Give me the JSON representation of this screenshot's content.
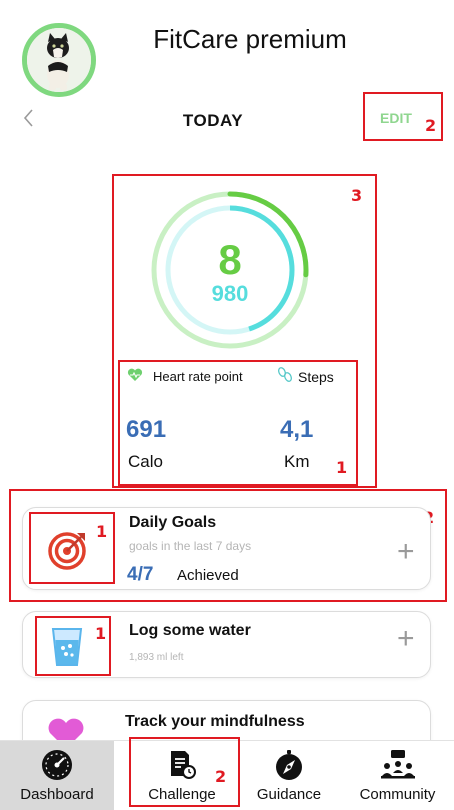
{
  "header": {
    "app_title": "FitCare premium",
    "day_label": "TODAY",
    "edit_label": "EDIT"
  },
  "ring": {
    "primary_value": "8",
    "secondary_value": "980",
    "primary_progress": 0.26,
    "secondary_progress": 0.45,
    "colors": {
      "primary": "#66cc44",
      "secondary": "#56dddd",
      "track_primary": "#c9f0c4",
      "track_secondary": "#d4f6f6"
    }
  },
  "stats": {
    "heart_label": "Heart rate point",
    "steps_label": "Steps",
    "calo_value": "691",
    "calo_unit": "Calo",
    "km_value": "4,1",
    "km_unit": "Km"
  },
  "cards": {
    "daily_goals": {
      "title": "Daily Goals",
      "subtitle": "goals in the last 7 days",
      "count": "4/7",
      "status": "Achieved"
    },
    "water": {
      "title": "Log some water",
      "subtitle": "1,893 ml left"
    },
    "mindfulness": {
      "title": "Track your mindfulness"
    }
  },
  "nav": {
    "items": [
      {
        "label": "Dashboard",
        "icon": "speedometer-icon",
        "active": true
      },
      {
        "label": "Challenge",
        "icon": "clipboard-clock-icon",
        "active": false
      },
      {
        "label": "Guidance",
        "icon": "compass-icon",
        "active": false
      },
      {
        "label": "Community",
        "icon": "people-icon",
        "active": false
      }
    ]
  },
  "annotations": {
    "marker_1": "1",
    "marker_2": "2",
    "marker_3": "3"
  },
  "colors": {
    "accent_green": "#8fd68f",
    "value_blue": "#3a6db5",
    "annotation_red": "#e01a22"
  }
}
